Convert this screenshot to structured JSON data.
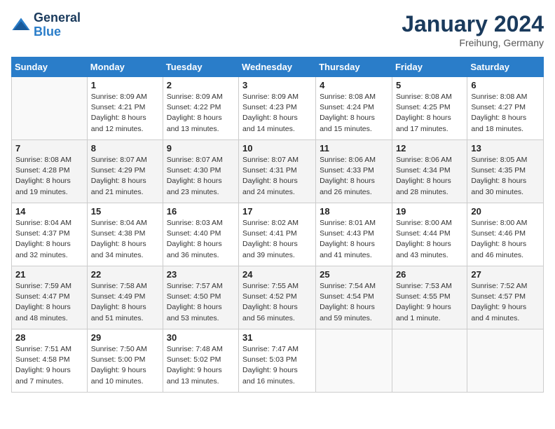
{
  "header": {
    "logo_general": "General",
    "logo_blue": "Blue",
    "month_title": "January 2024",
    "location": "Freihung, Germany"
  },
  "days_of_week": [
    "Sunday",
    "Monday",
    "Tuesday",
    "Wednesday",
    "Thursday",
    "Friday",
    "Saturday"
  ],
  "weeks": [
    [
      {
        "day": "",
        "info": ""
      },
      {
        "day": "1",
        "info": "Sunrise: 8:09 AM\nSunset: 4:21 PM\nDaylight: 8 hours\nand 12 minutes."
      },
      {
        "day": "2",
        "info": "Sunrise: 8:09 AM\nSunset: 4:22 PM\nDaylight: 8 hours\nand 13 minutes."
      },
      {
        "day": "3",
        "info": "Sunrise: 8:09 AM\nSunset: 4:23 PM\nDaylight: 8 hours\nand 14 minutes."
      },
      {
        "day": "4",
        "info": "Sunrise: 8:08 AM\nSunset: 4:24 PM\nDaylight: 8 hours\nand 15 minutes."
      },
      {
        "day": "5",
        "info": "Sunrise: 8:08 AM\nSunset: 4:25 PM\nDaylight: 8 hours\nand 17 minutes."
      },
      {
        "day": "6",
        "info": "Sunrise: 8:08 AM\nSunset: 4:27 PM\nDaylight: 8 hours\nand 18 minutes."
      }
    ],
    [
      {
        "day": "7",
        "info": "Sunrise: 8:08 AM\nSunset: 4:28 PM\nDaylight: 8 hours\nand 19 minutes."
      },
      {
        "day": "8",
        "info": "Sunrise: 8:07 AM\nSunset: 4:29 PM\nDaylight: 8 hours\nand 21 minutes."
      },
      {
        "day": "9",
        "info": "Sunrise: 8:07 AM\nSunset: 4:30 PM\nDaylight: 8 hours\nand 23 minutes."
      },
      {
        "day": "10",
        "info": "Sunrise: 8:07 AM\nSunset: 4:31 PM\nDaylight: 8 hours\nand 24 minutes."
      },
      {
        "day": "11",
        "info": "Sunrise: 8:06 AM\nSunset: 4:33 PM\nDaylight: 8 hours\nand 26 minutes."
      },
      {
        "day": "12",
        "info": "Sunrise: 8:06 AM\nSunset: 4:34 PM\nDaylight: 8 hours\nand 28 minutes."
      },
      {
        "day": "13",
        "info": "Sunrise: 8:05 AM\nSunset: 4:35 PM\nDaylight: 8 hours\nand 30 minutes."
      }
    ],
    [
      {
        "day": "14",
        "info": "Sunrise: 8:04 AM\nSunset: 4:37 PM\nDaylight: 8 hours\nand 32 minutes."
      },
      {
        "day": "15",
        "info": "Sunrise: 8:04 AM\nSunset: 4:38 PM\nDaylight: 8 hours\nand 34 minutes."
      },
      {
        "day": "16",
        "info": "Sunrise: 8:03 AM\nSunset: 4:40 PM\nDaylight: 8 hours\nand 36 minutes."
      },
      {
        "day": "17",
        "info": "Sunrise: 8:02 AM\nSunset: 4:41 PM\nDaylight: 8 hours\nand 39 minutes."
      },
      {
        "day": "18",
        "info": "Sunrise: 8:01 AM\nSunset: 4:43 PM\nDaylight: 8 hours\nand 41 minutes."
      },
      {
        "day": "19",
        "info": "Sunrise: 8:00 AM\nSunset: 4:44 PM\nDaylight: 8 hours\nand 43 minutes."
      },
      {
        "day": "20",
        "info": "Sunrise: 8:00 AM\nSunset: 4:46 PM\nDaylight: 8 hours\nand 46 minutes."
      }
    ],
    [
      {
        "day": "21",
        "info": "Sunrise: 7:59 AM\nSunset: 4:47 PM\nDaylight: 8 hours\nand 48 minutes."
      },
      {
        "day": "22",
        "info": "Sunrise: 7:58 AM\nSunset: 4:49 PM\nDaylight: 8 hours\nand 51 minutes."
      },
      {
        "day": "23",
        "info": "Sunrise: 7:57 AM\nSunset: 4:50 PM\nDaylight: 8 hours\nand 53 minutes."
      },
      {
        "day": "24",
        "info": "Sunrise: 7:55 AM\nSunset: 4:52 PM\nDaylight: 8 hours\nand 56 minutes."
      },
      {
        "day": "25",
        "info": "Sunrise: 7:54 AM\nSunset: 4:54 PM\nDaylight: 8 hours\nand 59 minutes."
      },
      {
        "day": "26",
        "info": "Sunrise: 7:53 AM\nSunset: 4:55 PM\nDaylight: 9 hours\nand 1 minute."
      },
      {
        "day": "27",
        "info": "Sunrise: 7:52 AM\nSunset: 4:57 PM\nDaylight: 9 hours\nand 4 minutes."
      }
    ],
    [
      {
        "day": "28",
        "info": "Sunrise: 7:51 AM\nSunset: 4:58 PM\nDaylight: 9 hours\nand 7 minutes."
      },
      {
        "day": "29",
        "info": "Sunrise: 7:50 AM\nSunset: 5:00 PM\nDaylight: 9 hours\nand 10 minutes."
      },
      {
        "day": "30",
        "info": "Sunrise: 7:48 AM\nSunset: 5:02 PM\nDaylight: 9 hours\nand 13 minutes."
      },
      {
        "day": "31",
        "info": "Sunrise: 7:47 AM\nSunset: 5:03 PM\nDaylight: 9 hours\nand 16 minutes."
      },
      {
        "day": "",
        "info": ""
      },
      {
        "day": "",
        "info": ""
      },
      {
        "day": "",
        "info": ""
      }
    ]
  ]
}
